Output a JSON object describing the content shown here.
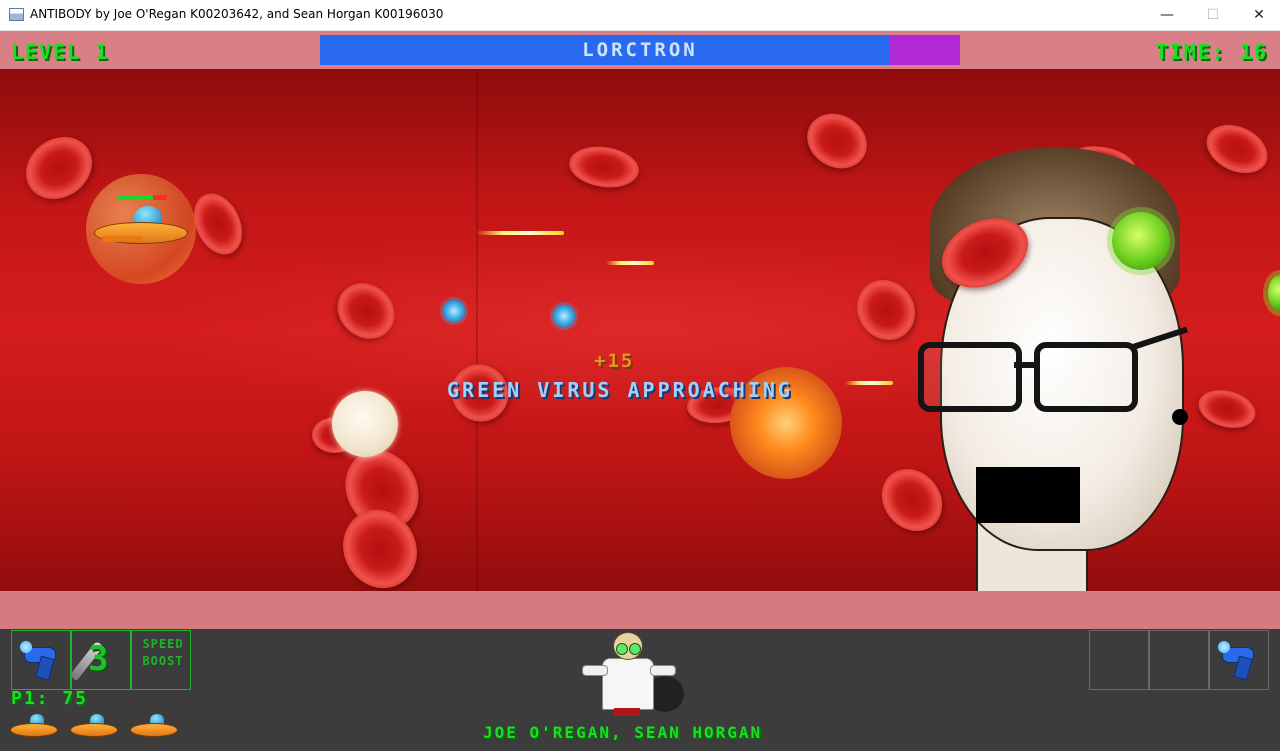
{
  "window": {
    "title": "ANTIBODY by Joe O'Regan K00203642, and Sean Horgan K00196030",
    "min_symbol": "—",
    "max_symbol": "☐",
    "close_symbol": "✕"
  },
  "hud": {
    "level": "LEVEL 1",
    "time": "TIME: 16",
    "boss_name": "LORCTRON",
    "boss_health_fraction": 0.89,
    "player_health_fraction": 0.72,
    "score_popup": "+15",
    "announcement": "GREEN VIRUS APPROACHING",
    "rockets": "3",
    "speed_boost": "SPEED BOOST",
    "p1_score": "P1: 75",
    "lives": 3,
    "credits": "JOE O'REGAN, SEAN HORGAN"
  },
  "icons": {
    "app": "window-app-icon",
    "player": "ship-icon",
    "weapon": "laser-gun-icon",
    "rocket": "rocket-icon",
    "professor": "professor-icon"
  },
  "colors": {
    "hud_green": "#18e021",
    "boss_bar": "#2a6af0",
    "boss_bar_back": "#b229d6",
    "vessel_band": "#d97f86",
    "hud_panel": "#3c3c3c"
  }
}
